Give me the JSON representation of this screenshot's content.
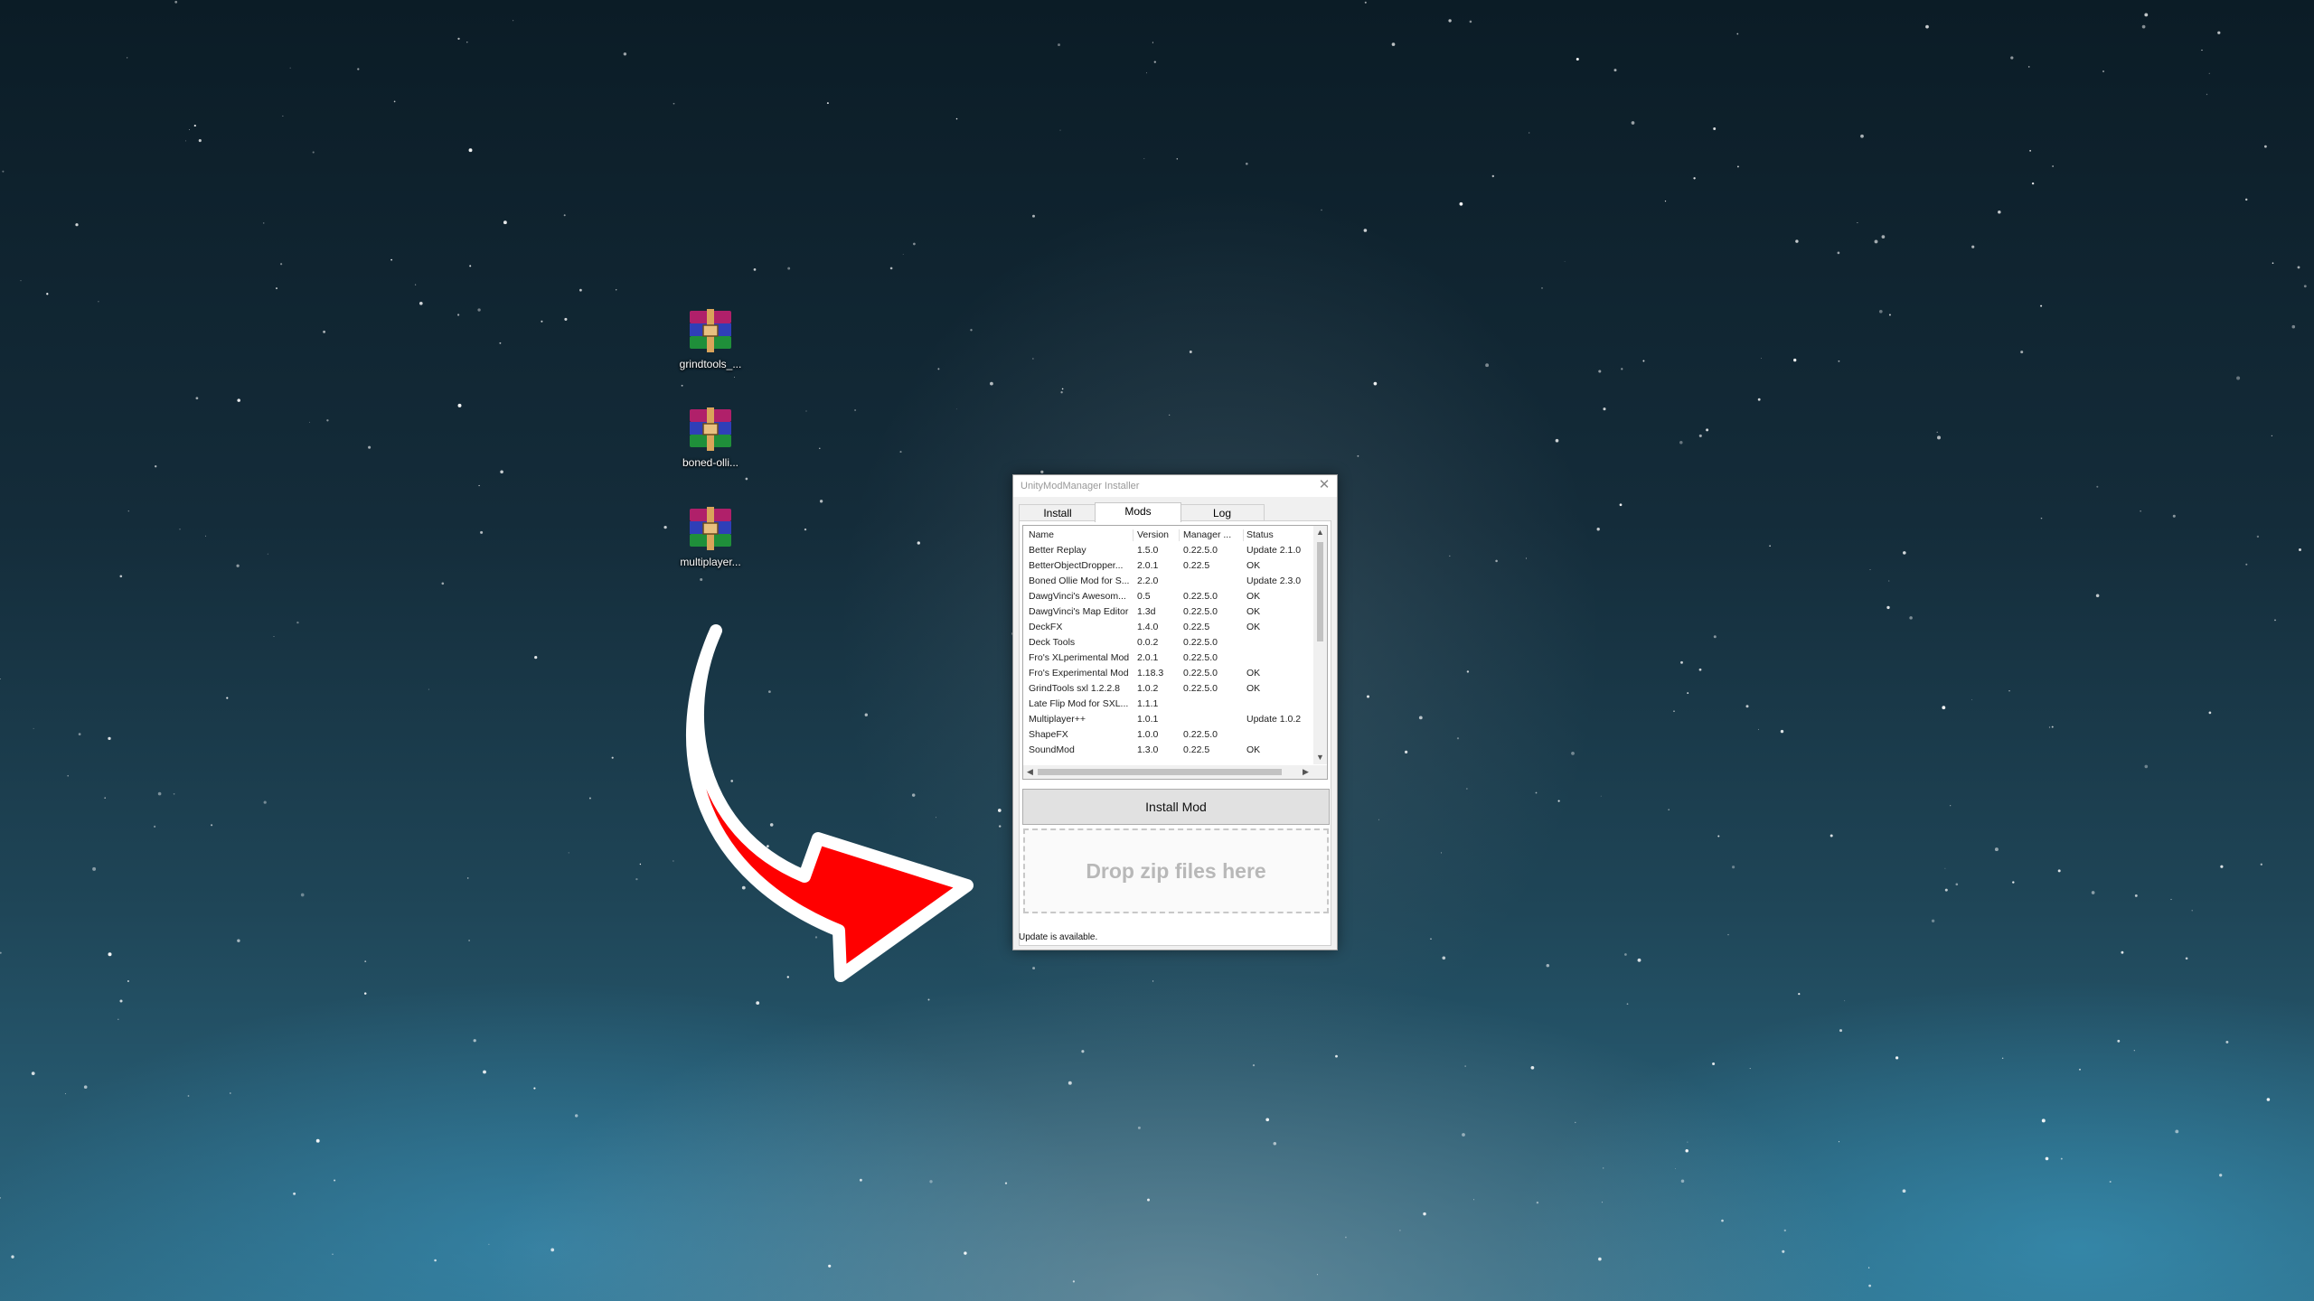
{
  "desktop": {
    "icons": [
      {
        "label": "grindtools_..."
      },
      {
        "label": "boned-olli..."
      },
      {
        "label": "multiplayer..."
      }
    ]
  },
  "window": {
    "title": "UnityModManager Installer",
    "tabs": [
      {
        "label": "Install"
      },
      {
        "label": "Mods"
      },
      {
        "label": "Log"
      }
    ],
    "active_tab": "Mods",
    "mods_table": {
      "columns": [
        "Name",
        "Version",
        "Manager ...",
        "Status"
      ],
      "rows": [
        [
          "Better Replay",
          "1.5.0",
          "0.22.5.0",
          "Update 2.1.0"
        ],
        [
          "BetterObjectDropper...",
          "2.0.1",
          "0.22.5",
          "OK"
        ],
        [
          "Boned Ollie Mod for S...",
          "2.2.0",
          "",
          "Update 2.3.0"
        ],
        [
          "DawgVinci's Awesom...",
          "0.5",
          "0.22.5.0",
          "OK"
        ],
        [
          "DawgVinci's Map Editor",
          "1.3d",
          "0.22.5.0",
          "OK"
        ],
        [
          "DeckFX",
          "1.4.0",
          "0.22.5",
          "OK"
        ],
        [
          "Deck Tools",
          "0.0.2",
          "0.22.5.0",
          ""
        ],
        [
          "Fro's XLperimental Mod",
          "2.0.1",
          "0.22.5.0",
          ""
        ],
        [
          "Fro's Experimental Mod",
          "1.18.3",
          "0.22.5.0",
          "OK"
        ],
        [
          "GrindTools sxl 1.2.2.8",
          "1.0.2",
          "0.22.5.0",
          "OK"
        ],
        [
          "Late Flip Mod for SXL...",
          "1.1.1",
          "",
          ""
        ],
        [
          "Multiplayer++",
          "1.0.1",
          "",
          "Update 1.0.2"
        ],
        [
          "ShapeFX",
          "1.0.0",
          "0.22.5.0",
          ""
        ],
        [
          "SoundMod",
          "1.3.0",
          "0.22.5",
          "OK"
        ]
      ]
    },
    "install_button": "Install Mod",
    "dropzone_text": "Drop zip files here",
    "status_text": "Update is available."
  },
  "colors": {
    "arrow": "#ff0000",
    "arrow_outline": "#ffffff"
  }
}
